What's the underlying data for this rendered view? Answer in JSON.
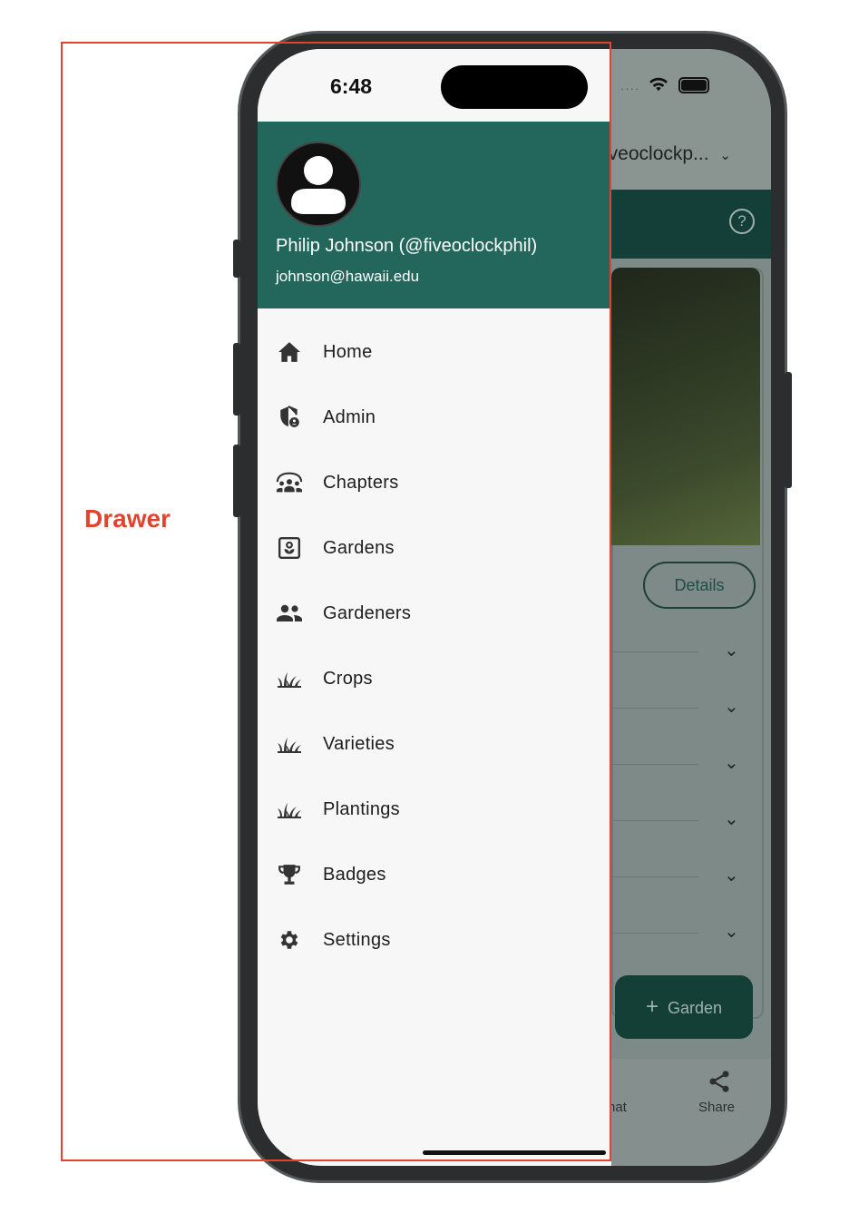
{
  "annotation": {
    "label": "Drawer",
    "color": "#e2432e"
  },
  "status_bar": {
    "time": "6:48"
  },
  "background_app": {
    "dropdown_text": "iveoclockp...",
    "details_button": "Details",
    "fab_label": "Garden",
    "nav_chat": "hat",
    "nav_share": "Share"
  },
  "drawer": {
    "header_color": "#23675c",
    "user_name": "Philip Johnson (@fiveoclockphil)",
    "user_email": "johnson@hawaii.edu",
    "items": [
      {
        "label": "Home",
        "icon": "home-icon"
      },
      {
        "label": "Admin",
        "icon": "admin-shield-icon"
      },
      {
        "label": "Chapters",
        "icon": "chapters-group-icon"
      },
      {
        "label": "Gardens",
        "icon": "garden-box-icon"
      },
      {
        "label": "Gardeners",
        "icon": "people-icon"
      },
      {
        "label": "Crops",
        "icon": "grass-icon"
      },
      {
        "label": "Varieties",
        "icon": "grass-icon"
      },
      {
        "label": "Plantings",
        "icon": "grass-icon"
      },
      {
        "label": "Badges",
        "icon": "trophy-icon"
      },
      {
        "label": "Settings",
        "icon": "gear-icon"
      }
    ]
  }
}
